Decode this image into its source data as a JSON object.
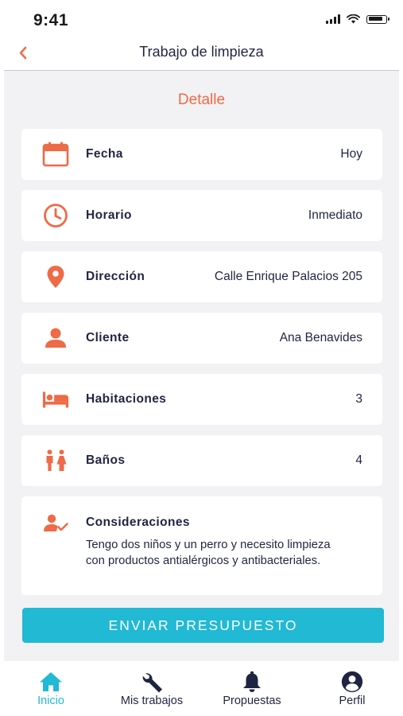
{
  "status_bar": {
    "time": "9:41"
  },
  "header": {
    "title": "Trabajo de limpieza"
  },
  "section": {
    "title": "Detalle"
  },
  "colors": {
    "accent": "#ef6a47",
    "primary": "#21b9d4",
    "text_dark": "#1f2540",
    "background": "#f2f2f4"
  },
  "details": [
    {
      "icon": "calendar-icon",
      "label": "Fecha",
      "value": "Hoy"
    },
    {
      "icon": "clock-icon",
      "label": "Horario",
      "value": "Inmediato"
    },
    {
      "icon": "location-pin-icon",
      "label": "Dirección",
      "value": "Calle Enrique Palacios 205"
    },
    {
      "icon": "person-icon",
      "label": "Cliente",
      "value": "Ana Benavides"
    },
    {
      "icon": "bed-icon",
      "label": "Habitaciones",
      "value": "3"
    },
    {
      "icon": "restroom-icon",
      "label": "Baños",
      "value": "4"
    }
  ],
  "considerations": {
    "icon": "user-check-icon",
    "label": "Consideraciones",
    "text": "Tengo dos niños y un perro y necesito limpieza con productos antialérgicos y antibacteriales."
  },
  "cta": {
    "label": "ENVIAR PRESUPUESTO"
  },
  "tabs": [
    {
      "icon": "home-icon",
      "label": "Inicio",
      "active": true
    },
    {
      "icon": "wrench-icon",
      "label": "Mis trabajos",
      "active": false
    },
    {
      "icon": "bell-icon",
      "label": "Propuestas",
      "active": false
    },
    {
      "icon": "profile-icon",
      "label": "Perfil",
      "active": false
    }
  ]
}
